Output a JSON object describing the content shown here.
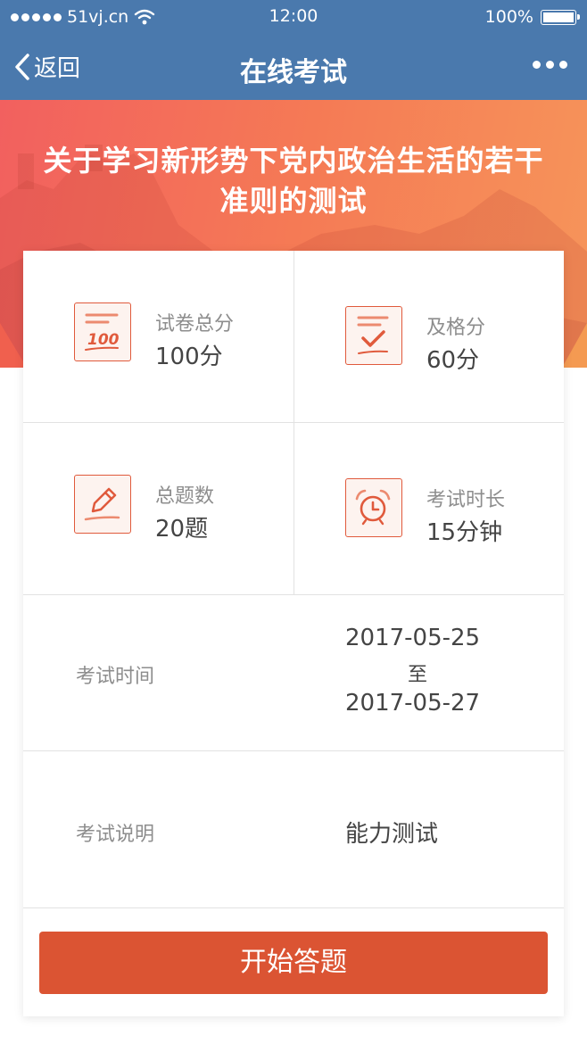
{
  "status_bar": {
    "carrier": "51vj.cn",
    "time": "12:00",
    "battery": "100%",
    "battery_level": 1.0
  },
  "nav": {
    "back_label": "返回",
    "title": "在线考试"
  },
  "exam": {
    "title_line1": "关于学习新形势下党内政治生活的若干",
    "title_line2": "准则的测试",
    "stats": [
      {
        "label": "试卷总分",
        "value": "100分",
        "icon": "score-sheet-icon",
        "icon_text": "100"
      },
      {
        "label": "及格分",
        "value": "60分",
        "icon": "pass-check-icon"
      },
      {
        "label": "总题数",
        "value": "20题",
        "icon": "pencil-icon"
      },
      {
        "label": "考试时长",
        "value": "15分钟",
        "icon": "alarm-clock-icon"
      }
    ],
    "time_label": "考试时间",
    "time_start": "2017-05-25",
    "time_to": "至",
    "time_end": "2017-05-27",
    "desc_label": "考试说明",
    "desc_value": "能力测试"
  },
  "start_button_label": "开始答题",
  "colors": {
    "nav_blue": "#4a79ad",
    "accent": "#db5433",
    "icon_stroke": "#e05a3c"
  }
}
